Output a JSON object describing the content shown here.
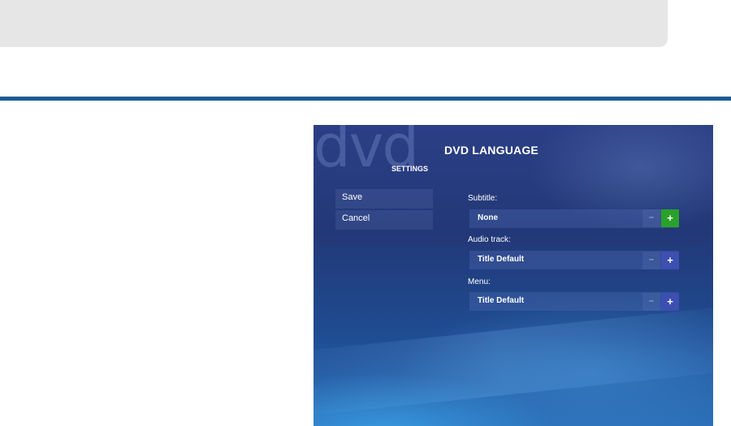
{
  "screen": {
    "watermark": "dvd",
    "title": "DVD LANGUAGE",
    "subtitle": "SETTINGS",
    "menu": [
      {
        "label": "Save"
      },
      {
        "label": "Cancel"
      }
    ],
    "fields": [
      {
        "label": "Subtitle:",
        "value": "None",
        "minus": "–",
        "plus": "+"
      },
      {
        "label": "Audio track:",
        "value": "Title Default",
        "minus": "–",
        "plus": "+"
      },
      {
        "label": "Menu:",
        "value": "Title Default",
        "minus": "–",
        "plus": "+"
      }
    ]
  },
  "colors": {
    "rule": "#1d5a94",
    "active_plus": "#2aa12b",
    "plus": "#3d4fb0"
  }
}
